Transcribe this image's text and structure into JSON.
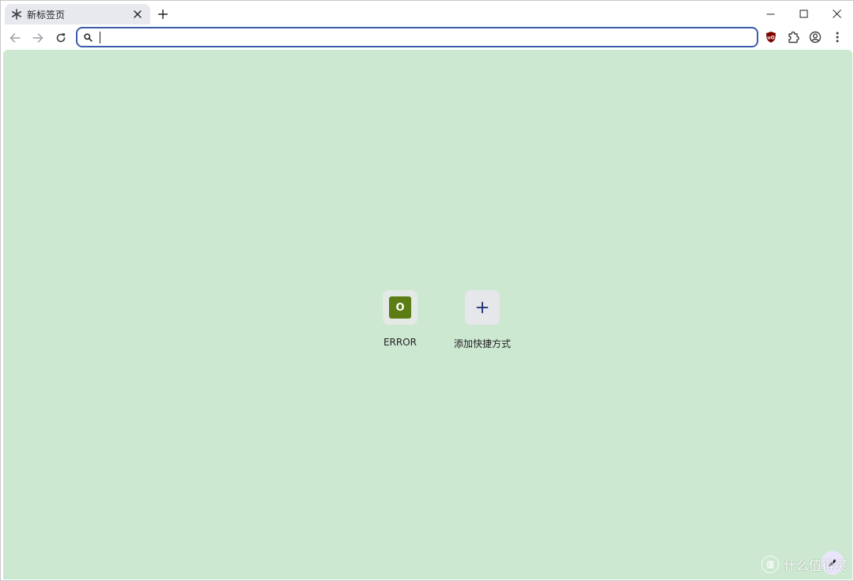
{
  "tab": {
    "title": "新标签页",
    "icon": "asterisk-icon"
  },
  "toolbar": {
    "back_icon": "arrow-left-icon",
    "forward_icon": "arrow-right-icon",
    "reload_icon": "reload-icon",
    "omnibox_value": "",
    "extensions": [
      "ublock-origin-icon",
      "puzzle-icon",
      "profile-icon",
      "kebab-menu-icon"
    ]
  },
  "shortcuts": [
    {
      "label": "ERROR",
      "favicon_letter": "O",
      "favicon_color": "#5c7d14"
    },
    {
      "label": "添加快捷方式",
      "icon": "plus-icon"
    }
  ],
  "colors": {
    "background": "#cde8d1",
    "omnibox_border": "#3c5ba9",
    "ublock_red": "#800000"
  },
  "watermark": {
    "text": "什么值得买"
  }
}
